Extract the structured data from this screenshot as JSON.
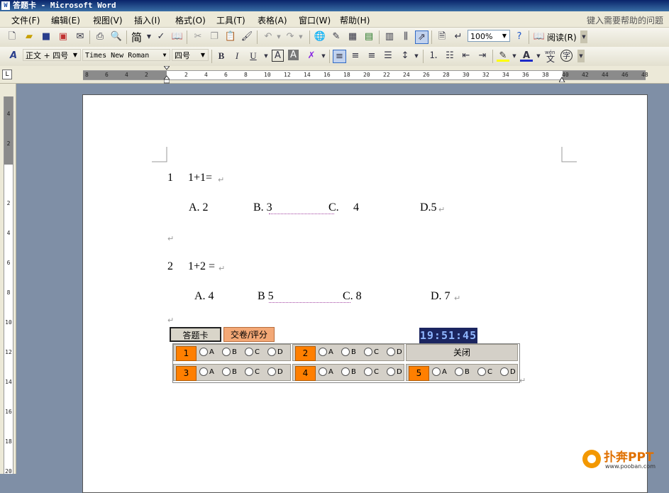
{
  "window": {
    "title": "答题卡 - Microsoft Word",
    "icon": "word-doc-icon"
  },
  "menu": {
    "items": [
      "文件(F)",
      "编辑(E)",
      "视图(V)",
      "插入(I)",
      "格式(O)",
      "工具(T)",
      "表格(A)",
      "窗口(W)",
      "帮助(H)"
    ],
    "help_placeholder": "键入需要帮助的问题"
  },
  "standard_toolbar": {
    "simplified_label": "简",
    "zoom": "100%",
    "read_label": "阅读(R)"
  },
  "format_toolbar": {
    "style": "正文 + 四号",
    "font": "Times New Roman",
    "size": "四号",
    "style_glyph": "A",
    "phonetic_glyph": "文",
    "phonetic_top": "wén"
  },
  "ruler": {
    "h_numbers": [
      "8",
      "6",
      "4",
      "2",
      "",
      "2",
      "4",
      "6",
      "8",
      "10",
      "12",
      "14",
      "16",
      "18",
      "20",
      "22",
      "24",
      "26",
      "28",
      "30",
      "32",
      "34",
      "36",
      "38",
      "40",
      "42",
      "44",
      "46",
      "48"
    ],
    "v_numbers": [
      "4",
      "2",
      "",
      "2",
      "4",
      "6",
      "8",
      "10",
      "12",
      "14",
      "16",
      "18",
      "20"
    ],
    "corner": "L"
  },
  "document": {
    "q1": {
      "number": "1",
      "stem": "1+1=",
      "a": "A. 2",
      "b": "B. 3",
      "c": "C.",
      "c_val": "4",
      "d": "D.5"
    },
    "q2": {
      "number": "2",
      "stem": "1+2 =",
      "a": "A. 4",
      "b": "B 5",
      "c": "C. 8",
      "d": "D. 7"
    },
    "para_mark": "↵"
  },
  "controls": {
    "answer_card_button": "答题卡",
    "submit_button": "交卷/评分",
    "clock": "19:51:45",
    "close_button": "关闭",
    "options": [
      "A",
      "B",
      "C",
      "D"
    ],
    "questions": [
      "1",
      "2",
      "3",
      "4",
      "5"
    ]
  },
  "watermark": {
    "brand": "扑奔PPT",
    "url": "www.pooban.com"
  },
  "colors": {
    "question_cell": "#ff7f00",
    "submit_bg": "#f3a876",
    "clock_bg": "#1b2560",
    "title_bar": "#0a246a"
  }
}
